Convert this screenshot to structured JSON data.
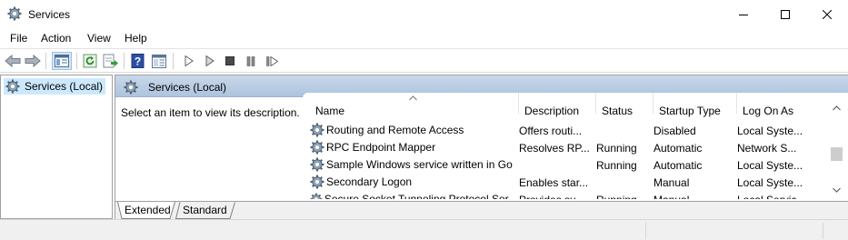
{
  "window": {
    "title": "Services"
  },
  "menu": [
    "File",
    "Action",
    "View",
    "Help"
  ],
  "tree": {
    "root_label": "Services (Local)"
  },
  "content": {
    "header_title": "Services (Local)",
    "description_hint": "Select an item to view its description."
  },
  "table": {
    "columns": [
      "Name",
      "Description",
      "Status",
      "Startup Type",
      "Log On As"
    ],
    "rows": [
      [
        "Routing and Remote Access",
        "Offers routi...",
        "",
        "Disabled",
        "Local Syste..."
      ],
      [
        "RPC Endpoint Mapper",
        "Resolves RP...",
        "Running",
        "Automatic",
        "Network S..."
      ],
      [
        "Sample Windows service written in Go",
        "",
        "Running",
        "Automatic",
        "Local Syste..."
      ],
      [
        "Secondary Logon",
        "Enables star...",
        "",
        "Manual",
        "Local Syste..."
      ],
      [
        "Secure Socket Tunneling Protocol Ser...",
        "Provides su...",
        "Running",
        "Manual",
        "Local Servic..."
      ]
    ]
  },
  "tabs": [
    "Extended",
    "Standard"
  ],
  "colors": {
    "header_blue": "#adc3dd",
    "selection": "#cce8ff",
    "gear": "#6c7a8a"
  }
}
